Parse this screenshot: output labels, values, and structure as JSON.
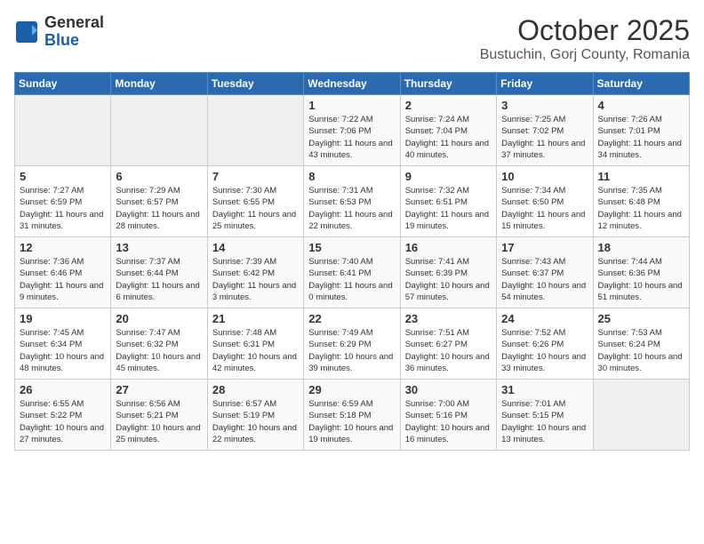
{
  "header": {
    "logo_general": "General",
    "logo_blue": "Blue",
    "month_title": "October 2025",
    "location": "Bustuchin, Gorj County, Romania"
  },
  "weekdays": [
    "Sunday",
    "Monday",
    "Tuesday",
    "Wednesday",
    "Thursday",
    "Friday",
    "Saturday"
  ],
  "weeks": [
    [
      {
        "day": "",
        "info": ""
      },
      {
        "day": "",
        "info": ""
      },
      {
        "day": "",
        "info": ""
      },
      {
        "day": "1",
        "info": "Sunrise: 7:22 AM\nSunset: 7:06 PM\nDaylight: 11 hours and 43 minutes."
      },
      {
        "day": "2",
        "info": "Sunrise: 7:24 AM\nSunset: 7:04 PM\nDaylight: 11 hours and 40 minutes."
      },
      {
        "day": "3",
        "info": "Sunrise: 7:25 AM\nSunset: 7:02 PM\nDaylight: 11 hours and 37 minutes."
      },
      {
        "day": "4",
        "info": "Sunrise: 7:26 AM\nSunset: 7:01 PM\nDaylight: 11 hours and 34 minutes."
      }
    ],
    [
      {
        "day": "5",
        "info": "Sunrise: 7:27 AM\nSunset: 6:59 PM\nDaylight: 11 hours and 31 minutes."
      },
      {
        "day": "6",
        "info": "Sunrise: 7:29 AM\nSunset: 6:57 PM\nDaylight: 11 hours and 28 minutes."
      },
      {
        "day": "7",
        "info": "Sunrise: 7:30 AM\nSunset: 6:55 PM\nDaylight: 11 hours and 25 minutes."
      },
      {
        "day": "8",
        "info": "Sunrise: 7:31 AM\nSunset: 6:53 PM\nDaylight: 11 hours and 22 minutes."
      },
      {
        "day": "9",
        "info": "Sunrise: 7:32 AM\nSunset: 6:51 PM\nDaylight: 11 hours and 19 minutes."
      },
      {
        "day": "10",
        "info": "Sunrise: 7:34 AM\nSunset: 6:50 PM\nDaylight: 11 hours and 15 minutes."
      },
      {
        "day": "11",
        "info": "Sunrise: 7:35 AM\nSunset: 6:48 PM\nDaylight: 11 hours and 12 minutes."
      }
    ],
    [
      {
        "day": "12",
        "info": "Sunrise: 7:36 AM\nSunset: 6:46 PM\nDaylight: 11 hours and 9 minutes."
      },
      {
        "day": "13",
        "info": "Sunrise: 7:37 AM\nSunset: 6:44 PM\nDaylight: 11 hours and 6 minutes."
      },
      {
        "day": "14",
        "info": "Sunrise: 7:39 AM\nSunset: 6:42 PM\nDaylight: 11 hours and 3 minutes."
      },
      {
        "day": "15",
        "info": "Sunrise: 7:40 AM\nSunset: 6:41 PM\nDaylight: 11 hours and 0 minutes."
      },
      {
        "day": "16",
        "info": "Sunrise: 7:41 AM\nSunset: 6:39 PM\nDaylight: 10 hours and 57 minutes."
      },
      {
        "day": "17",
        "info": "Sunrise: 7:43 AM\nSunset: 6:37 PM\nDaylight: 10 hours and 54 minutes."
      },
      {
        "day": "18",
        "info": "Sunrise: 7:44 AM\nSunset: 6:36 PM\nDaylight: 10 hours and 51 minutes."
      }
    ],
    [
      {
        "day": "19",
        "info": "Sunrise: 7:45 AM\nSunset: 6:34 PM\nDaylight: 10 hours and 48 minutes."
      },
      {
        "day": "20",
        "info": "Sunrise: 7:47 AM\nSunset: 6:32 PM\nDaylight: 10 hours and 45 minutes."
      },
      {
        "day": "21",
        "info": "Sunrise: 7:48 AM\nSunset: 6:31 PM\nDaylight: 10 hours and 42 minutes."
      },
      {
        "day": "22",
        "info": "Sunrise: 7:49 AM\nSunset: 6:29 PM\nDaylight: 10 hours and 39 minutes."
      },
      {
        "day": "23",
        "info": "Sunrise: 7:51 AM\nSunset: 6:27 PM\nDaylight: 10 hours and 36 minutes."
      },
      {
        "day": "24",
        "info": "Sunrise: 7:52 AM\nSunset: 6:26 PM\nDaylight: 10 hours and 33 minutes."
      },
      {
        "day": "25",
        "info": "Sunrise: 7:53 AM\nSunset: 6:24 PM\nDaylight: 10 hours and 30 minutes."
      }
    ],
    [
      {
        "day": "26",
        "info": "Sunrise: 6:55 AM\nSunset: 5:22 PM\nDaylight: 10 hours and 27 minutes."
      },
      {
        "day": "27",
        "info": "Sunrise: 6:56 AM\nSunset: 5:21 PM\nDaylight: 10 hours and 25 minutes."
      },
      {
        "day": "28",
        "info": "Sunrise: 6:57 AM\nSunset: 5:19 PM\nDaylight: 10 hours and 22 minutes."
      },
      {
        "day": "29",
        "info": "Sunrise: 6:59 AM\nSunset: 5:18 PM\nDaylight: 10 hours and 19 minutes."
      },
      {
        "day": "30",
        "info": "Sunrise: 7:00 AM\nSunset: 5:16 PM\nDaylight: 10 hours and 16 minutes."
      },
      {
        "day": "31",
        "info": "Sunrise: 7:01 AM\nSunset: 5:15 PM\nDaylight: 10 hours and 13 minutes."
      },
      {
        "day": "",
        "info": ""
      }
    ]
  ]
}
